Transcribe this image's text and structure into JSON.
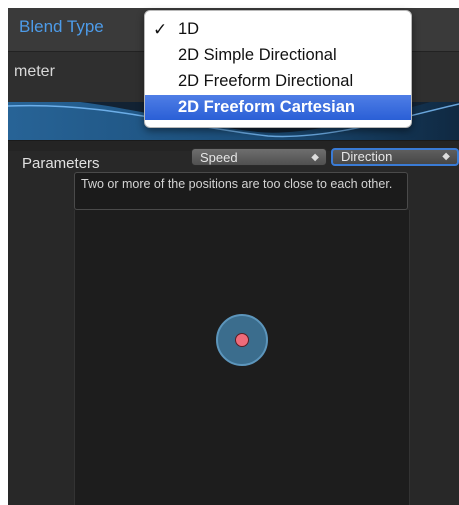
{
  "blend_type": {
    "label": "Blend Type"
  },
  "parameter_row": {
    "label_fragment": "meter"
  },
  "popup_menu": {
    "check_glyph": "✓",
    "items": [
      {
        "label": "1D",
        "checked": true
      },
      {
        "label": "2D Simple Directional",
        "checked": false
      },
      {
        "label": "2D Freeform Directional",
        "checked": false
      },
      {
        "label": "2D Freeform Cartesian",
        "checked": false,
        "highlighted": true
      }
    ]
  },
  "parameters": {
    "label": "Parameters",
    "x_param": {
      "value": "Speed",
      "arrows": "◆"
    },
    "y_param": {
      "value": "Direction",
      "arrows": "◆"
    }
  },
  "warning": {
    "text": "Two or more of the positions are too close to each other."
  },
  "colors": {
    "accent_blue": "#4d9be8",
    "menu_highlight": "#2a5fd6",
    "node_fill": "#3b6d8d",
    "node_point": "#ef6b7a"
  },
  "icons": [
    "checkmark-icon",
    "dropdown-arrows-icon",
    "blend-node-icon"
  ]
}
